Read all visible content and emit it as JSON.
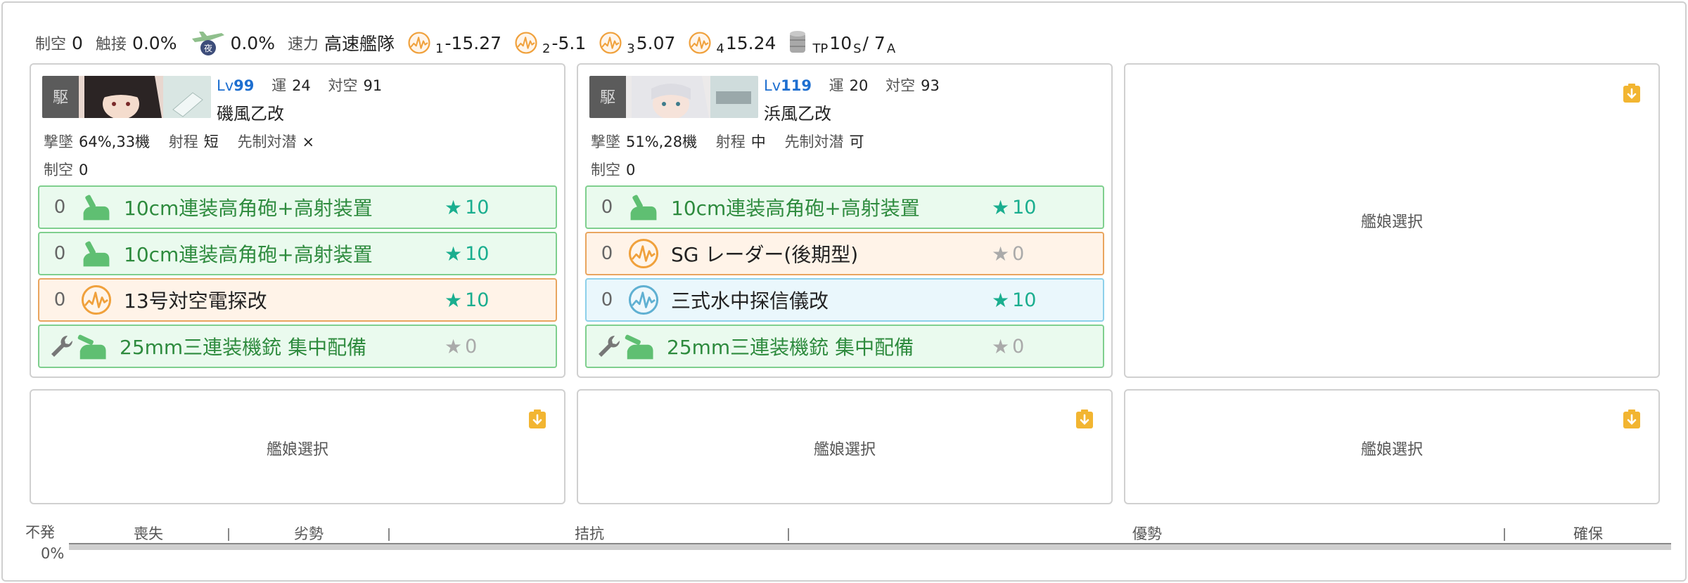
{
  "summary": {
    "air_label": "制空",
    "air_value": "0",
    "contact_label": "触接",
    "contact_value": "0.0%",
    "night_contact_value": "0.0%",
    "speed_label": "速力",
    "speed_value": "高速艦隊",
    "los": [
      {
        "sub": "1",
        "value": "-15.27"
      },
      {
        "sub": "2",
        "value": "-5.1"
      },
      {
        "sub": "3",
        "value": "5.07"
      },
      {
        "sub": "4",
        "value": "15.24"
      }
    ],
    "tp_sub": "TP",
    "tp_s_value": "10",
    "tp_s_sub": "S",
    "tp_sep": "/ 7",
    "tp_a_sub": "A"
  },
  "ships": [
    {
      "lv_prefix": "Lv",
      "lv": "99",
      "luck_label": "運",
      "luck": "24",
      "aa_label": "対空",
      "aa": "91",
      "name": "磯風乙改",
      "shootdown_label": "撃墜",
      "shootdown": "64%,33機",
      "range_label": "射程",
      "range": "短",
      "oasw_label": "先制対潜",
      "oasw": "×",
      "air_label": "制空",
      "air": "0",
      "equipment": [
        {
          "slot": "0",
          "name": "10cm連装高角砲+高射装置",
          "improvement": "10",
          "type": "green"
        },
        {
          "slot": "0",
          "name": "10cm連装高角砲+高射装置",
          "improvement": "10",
          "type": "green"
        },
        {
          "slot": "0",
          "name": "13号対空電探改",
          "improvement": "10",
          "type": "orange"
        },
        {
          "slot": "",
          "name": "25mm三連装機銃 集中配備",
          "improvement": "0",
          "type": "green"
        }
      ]
    },
    {
      "lv_prefix": "Lv",
      "lv": "119",
      "luck_label": "運",
      "luck": "20",
      "aa_label": "対空",
      "aa": "93",
      "name": "浜風乙改",
      "shootdown_label": "撃墜",
      "shootdown": "51%,28機",
      "range_label": "射程",
      "range": "中",
      "oasw_label": "先制対潜",
      "oasw": "可",
      "air_label": "制空",
      "air": "0",
      "equipment": [
        {
          "slot": "0",
          "name": "10cm連装高角砲+高射装置",
          "improvement": "10",
          "type": "green"
        },
        {
          "slot": "0",
          "name": "SG レーダー(後期型)",
          "improvement": "0",
          "type": "orange"
        },
        {
          "slot": "0",
          "name": "三式水中探信儀改",
          "improvement": "10",
          "type": "blue"
        },
        {
          "slot": "",
          "name": "25mm三連装機銃 集中配備",
          "improvement": "0",
          "type": "green"
        }
      ]
    }
  ],
  "empty_slot_label": "艦娘選択",
  "gauge": {
    "left_top": "不発",
    "left_bottom": "0%",
    "segments": [
      "喪失",
      "劣勢",
      "拮抗",
      "優勢",
      "確保"
    ]
  },
  "colors": {
    "accent": "#1e6fd0",
    "green_border": "#7fcf8e",
    "orange_border": "#e9a55f",
    "blue_border": "#8dd0ea",
    "star_on": "#1aae8f",
    "save_icon": "#f2b531"
  }
}
